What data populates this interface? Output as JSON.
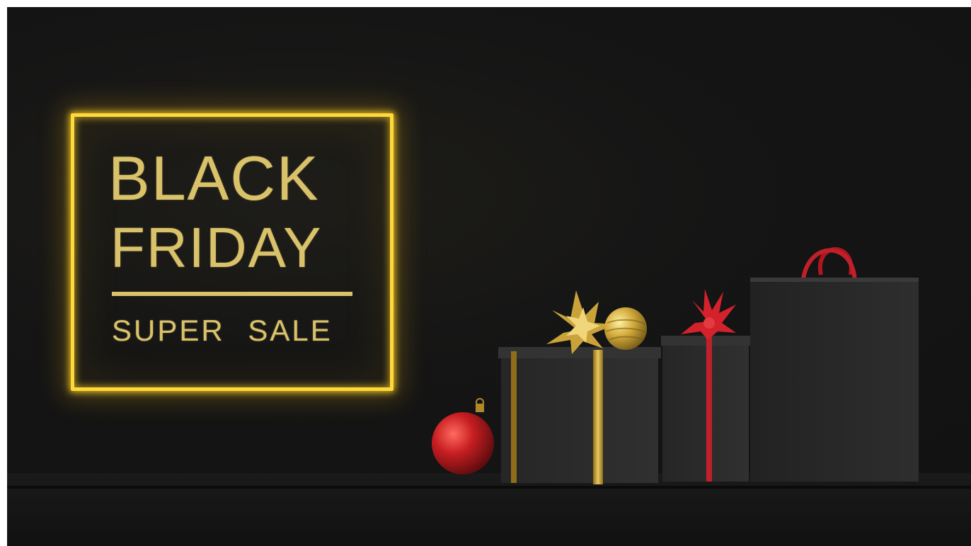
{
  "banner": {
    "title_line1": "BLACK",
    "title_line2": "FRIDAY",
    "subtitle": "SUPER SALE"
  },
  "colors": {
    "background": "#151515",
    "neon_gold": "#ffd83a",
    "text_gold": "#d9c26a",
    "ribbon_red": "#c0202a",
    "gift_box": "#2a2a2a"
  },
  "objects": [
    "red-ornament",
    "gold-ornament",
    "gift-box-gold-bow",
    "gift-box-red-bow",
    "shopping-bag"
  ]
}
